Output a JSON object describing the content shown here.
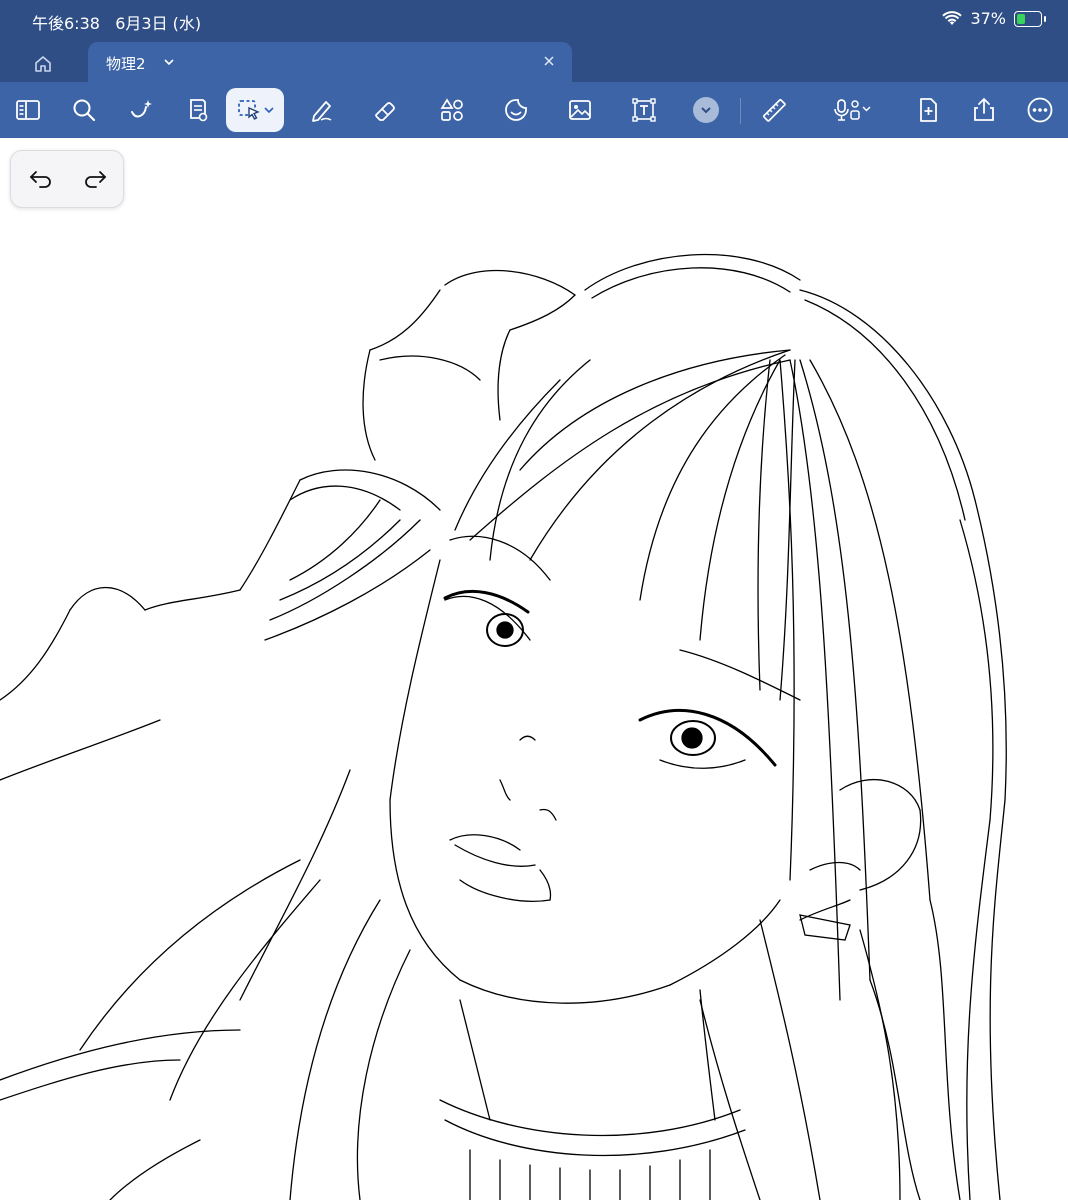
{
  "status_bar": {
    "time": "午後6:38",
    "date": "6月3日 (水)",
    "battery": "37%",
    "battery_level": 0.37
  },
  "tab_bar": {
    "document_title": "物理2"
  },
  "toolbar": {
    "tools": [
      "sidebar-icon",
      "search-icon",
      "ai-assist-icon",
      "document-icon",
      "lasso-select-icon",
      "pen-icon",
      "eraser-icon",
      "shapes-icon",
      "sticker-icon",
      "image-icon",
      "text-box-icon",
      "more-tools-dropdown-icon",
      "ruler-icon",
      "microphone-icon",
      "add-page-icon",
      "share-icon",
      "more-icon"
    ],
    "active_tool": "lasso-select-icon"
  },
  "colors": {
    "bar_dark": "#2f4e86",
    "bar": "#3c64a6",
    "ink": "#000000",
    "canvas": "#ffffff"
  }
}
